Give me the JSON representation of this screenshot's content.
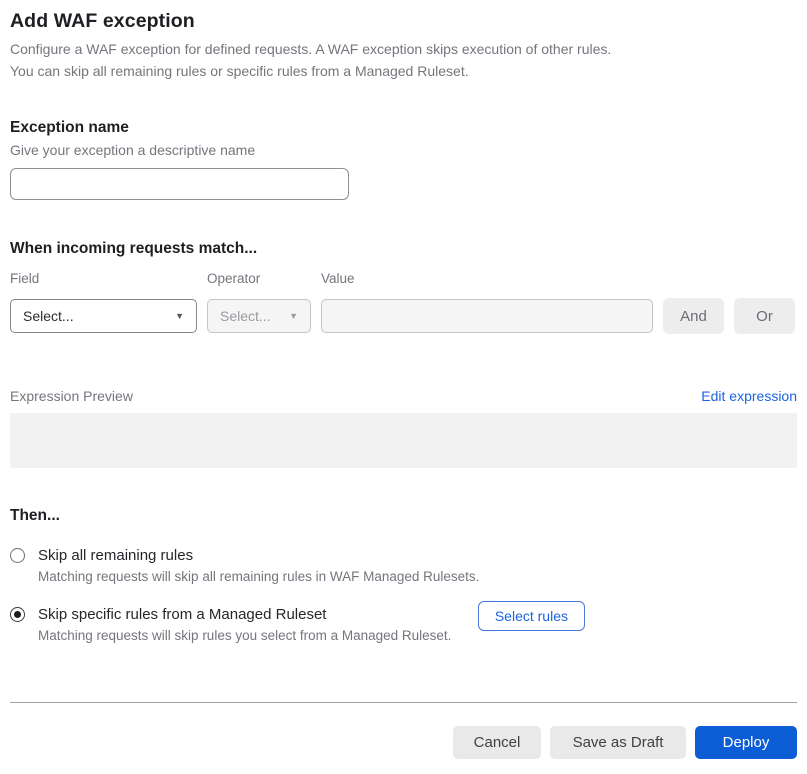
{
  "header": {
    "title": "Add WAF exception",
    "description_line1": "Configure a WAF exception for defined requests. A WAF exception skips execution of other rules.",
    "description_line2": "You can skip all remaining rules or specific rules from a Managed Ruleset."
  },
  "exception_name": {
    "heading": "Exception name",
    "hint": "Give your exception a descriptive name",
    "value": "",
    "placeholder": ""
  },
  "match": {
    "heading": "When incoming requests match...",
    "field": {
      "label": "Field",
      "selected_value": "Select...",
      "enabled": true
    },
    "operator": {
      "label": "Operator",
      "selected_value": "Select...",
      "enabled": false
    },
    "value": {
      "label": "Value",
      "value": "",
      "enabled": false
    },
    "and_label": "And",
    "or_label": "Or"
  },
  "expression": {
    "label": "Expression Preview",
    "edit_link_label": "Edit expression",
    "preview_value": ""
  },
  "then_section": {
    "heading": "Then...",
    "options": [
      {
        "label": "Skip all remaining rules",
        "description": "Matching requests will skip all remaining rules in WAF Managed Rulesets.",
        "selected": false
      },
      {
        "label": "Skip specific rules from a Managed Ruleset",
        "description": "Matching requests will skip rules you select from a Managed Ruleset.",
        "selected": true
      }
    ],
    "select_rules_label": "Select rules"
  },
  "footer": {
    "cancel_label": "Cancel",
    "save_draft_label": "Save as Draft",
    "deploy_label": "Deploy"
  },
  "icons": {
    "chevron_down": "▼"
  },
  "colors": {
    "link_blue": "#1b64e2",
    "deploy_blue": "#0b5cd5",
    "disabled_bg": "#f5f5f5",
    "preview_bg": "#f2f2f3"
  }
}
